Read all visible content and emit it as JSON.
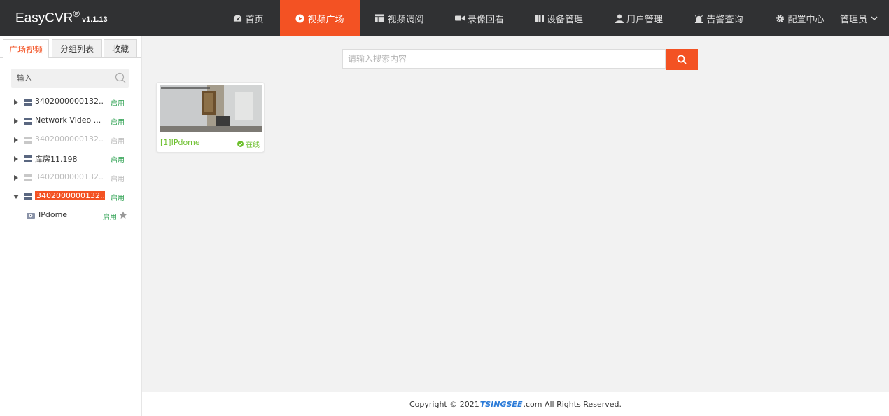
{
  "header": {
    "brand": "EasyCVR",
    "brand_mark": "®",
    "version": "v1.1.13",
    "nav": [
      {
        "label": "首页",
        "icon": "dashboard-icon"
      },
      {
        "label": "视频广场",
        "icon": "play-circle-icon",
        "active": true
      },
      {
        "label": "视频调阅",
        "icon": "layout-icon"
      },
      {
        "label": "录像回看",
        "icon": "video-camera-icon"
      },
      {
        "label": "设备管理",
        "icon": "device-icon"
      },
      {
        "label": "用户管理",
        "icon": "user-icon"
      },
      {
        "label": "告警查询",
        "icon": "alarm-icon"
      },
      {
        "label": "配置中心",
        "icon": "gear-icon"
      }
    ],
    "user": "管理员"
  },
  "sidebar": {
    "tabs": [
      "广场视频",
      "分组列表",
      "收藏"
    ],
    "search_placeholder": "输入",
    "tree": [
      {
        "name": "3402000000132...",
        "status": "启用",
        "disabled": false
      },
      {
        "name": "Network Video ...",
        "status": "启用",
        "disabled": false
      },
      {
        "name": "3402000000132...",
        "status": "启用",
        "disabled": true
      },
      {
        "name": "库房11.198",
        "status": "启用",
        "disabled": false
      },
      {
        "name": "3402000000132...",
        "status": "启用",
        "disabled": true
      },
      {
        "name": "3402000000132...",
        "status": "启用",
        "disabled": false,
        "selected": true,
        "expanded": true
      }
    ],
    "child": {
      "name": "IPdome",
      "status": "启用"
    }
  },
  "main": {
    "search_placeholder": "请输入搜索内容",
    "cards": [
      {
        "title": "[1]IPdome",
        "status": "在线"
      }
    ]
  },
  "footer": {
    "prefix": "Copyright © 2021 ",
    "brand": "TSINGSEE",
    "suffix": ".com All Rights Reserved."
  },
  "colors": {
    "accent": "#f35223",
    "header": "#303133",
    "enabled": "#31a354",
    "online": "#6cbf2c"
  }
}
